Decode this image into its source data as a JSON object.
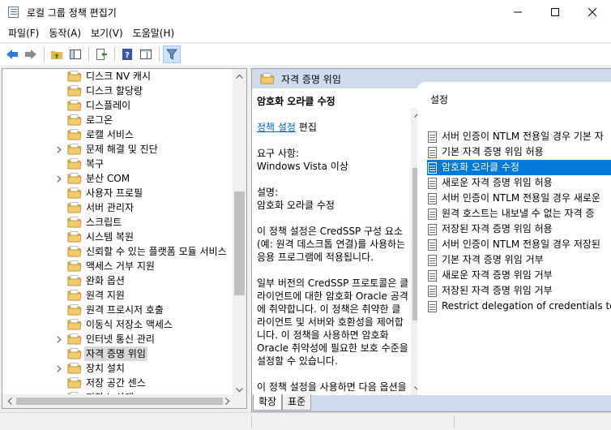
{
  "window": {
    "title": "로컬 그룹 정책 편집기",
    "buttons": {
      "minimize": "minimize",
      "maximize": "maximize",
      "close": "close"
    }
  },
  "menu": [
    "파일(F)",
    "동작(A)",
    "보기(V)",
    "도움말(H)"
  ],
  "toolbar": {
    "icons": [
      "back-icon",
      "forward-icon",
      "up-folder-icon",
      "show-hide-tree-icon",
      "export-list-icon",
      "help-icon",
      "properties-pane-icon",
      "filter-icon"
    ]
  },
  "tree": {
    "items": [
      {
        "label": "디스크 NV 캐시",
        "expandable": false
      },
      {
        "label": "디스크 할당량",
        "expandable": false
      },
      {
        "label": "디스플레이",
        "expandable": false
      },
      {
        "label": "로그온",
        "expandable": false
      },
      {
        "label": "로캘 서비스",
        "expandable": false
      },
      {
        "label": "문제 해결 및 진단",
        "expandable": true
      },
      {
        "label": "복구",
        "expandable": false
      },
      {
        "label": "분산 COM",
        "expandable": true
      },
      {
        "label": "사용자 프로필",
        "expandable": false
      },
      {
        "label": "서버 관리자",
        "expandable": false
      },
      {
        "label": "스크립트",
        "expandable": false
      },
      {
        "label": "시스템 복원",
        "expandable": false
      },
      {
        "label": "신뢰할 수 있는 플랫폼 모듈 서비스",
        "expandable": false
      },
      {
        "label": "액세스 거부 지원",
        "expandable": false
      },
      {
        "label": "완화 옵션",
        "expandable": false
      },
      {
        "label": "원격 지원",
        "expandable": false
      },
      {
        "label": "원격 프로시저 호출",
        "expandable": false
      },
      {
        "label": "이동식 저장소 액세스",
        "expandable": false
      },
      {
        "label": "인터넷 통신 관리",
        "expandable": true
      },
      {
        "label": "자격 증명 위임",
        "expandable": false,
        "selected": true
      },
      {
        "label": "장치 설치",
        "expandable": true
      },
      {
        "label": "저장 공간 센스",
        "expandable": false
      },
      {
        "label": "저장소 상태",
        "expandable": false
      }
    ]
  },
  "right": {
    "header_title": "자격 증명 위임",
    "description": {
      "title": "암호화 오라클 수정",
      "edit_link": "정책 설정",
      "edit_suffix": " 편집",
      "requirements_label": "요구 사항:",
      "requirements_value": "Windows Vista 이상",
      "desc_label": "설명:",
      "desc_value": "암호화 오라클 수정",
      "para1": "이 정책 설정은 CredSSP 구성 요소(예: 원격 데스크톱 연결)를 사용하는 응용 프로그램에 적용됩니다.",
      "para2": "일부 버전의 CredSSP 프로토콜은 클라이언트에 대한 암호화 Oracle 공격에 취약합니다. 이 정책은 취약한 클라이언트 및 서버와 호환성을 제어합니다. 이 정책을 사용하면 암호화 Oracle 취약성에 필요한 보호 수준을 설정할 수 있습니다.",
      "para3": "이 정책 설정을 사용하면 다음 옵션을 기반으로 CredSSP 버전 지원"
    },
    "settings_header": "설정",
    "settings": [
      "서버 인증이 NTLM 전용일 경우 기본 자",
      "기본 자격 증명 위임 허용",
      "암호화 오라클 수정",
      "새로운 자격 증명 위임 허용",
      "서버 인증이 NTLM 전용일 경우 새로운",
      "원격 호스트는 내보낼 수 없는 자격 증",
      "저장된 자격 증명 위임 허용",
      "서버 인증이 NTLM 전용일 경우 저장된",
      "기본 자격 증명 위임 거부",
      "새로운 자격 증명 위임 거부",
      "저장된 자격 증명 위임 거부",
      "Restrict delegation of credentials to re"
    ],
    "selected_setting_index": 2
  },
  "tabs": [
    "확장",
    "표준"
  ],
  "colors": {
    "selection": "#0078d7",
    "header_bg": "#cfdcee",
    "link": "#0066cc",
    "folder": "#e8b84b"
  }
}
